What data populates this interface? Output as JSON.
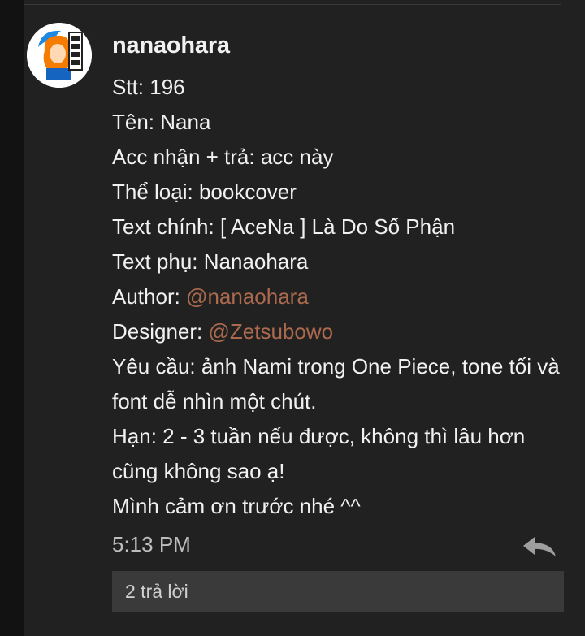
{
  "post": {
    "username": "nanaohara",
    "lines": {
      "stt": "Stt: 196",
      "ten": "Tên: Nana",
      "acc": "Acc nhận + trả: acc này",
      "theloai": "Thể loại: bookcover",
      "textchinh": "Text chính: [ AceNa ] Là Do Số Phận",
      "textphu": "Text phụ: Nanaohara",
      "author_label": "Author: ",
      "author_mention": "@nanaohara",
      "designer_label": "Designer: ",
      "designer_mention": "@Zetsubowo",
      "yeucau": "Yêu cầu: ảnh Nami trong One Piece, tone tối và font dễ nhìn một chút.",
      "han": "Hạn: 2 - 3 tuần nếu được, không thì lâu hơn cũng không sao ạ!",
      "cam_on": "Mình cảm ơn trước nhé ^^"
    },
    "time": "5:13 PM",
    "replies_label": "2 trả lời",
    "colors": {
      "background": "#212121",
      "text": "#f1f1f1",
      "mention": "#ab6a4d",
      "replies_bar": "#3a3a3a"
    },
    "icons": {
      "avatar": "avatar-image",
      "reply": "reply-arrow-icon"
    }
  }
}
